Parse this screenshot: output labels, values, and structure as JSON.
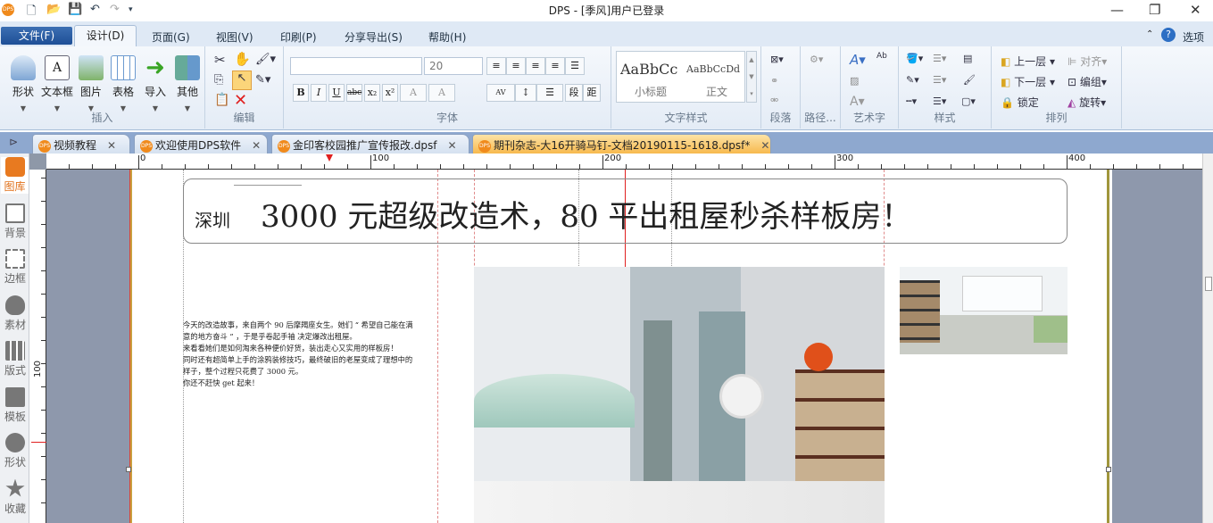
{
  "window": {
    "title": "DPS - [季风]用户已登录",
    "minimize": "—",
    "restore": "❐",
    "close": "✕"
  },
  "quick_access": [
    "new-file",
    "open",
    "save",
    "undo",
    "redo",
    "customize"
  ],
  "menu": {
    "file": "文件(F)",
    "tabs": [
      "设计(D)",
      "页面(G)",
      "视图(V)",
      "印刷(P)",
      "分享导出(S)",
      "帮助(H)"
    ],
    "options": "选项"
  },
  "ribbon": {
    "insert": {
      "label": "插入",
      "items": [
        "形状",
        "文本框",
        "图片",
        "表格",
        "导入",
        "其他"
      ]
    },
    "edit": {
      "label": "编辑"
    },
    "font": {
      "label": "字体",
      "font_name": "",
      "font_size": "20",
      "buttons": [
        "B",
        "I",
        "U",
        "abc",
        "x₂",
        "x²",
        "A",
        "A"
      ],
      "para_buttons": [
        "AV",
        "段",
        "距"
      ]
    },
    "text_style": {
      "label": "文字样式",
      "styles": [
        {
          "sample": "AaBbCc",
          "name": "小标题"
        },
        {
          "sample": "AaBbCcDd",
          "name": "正文"
        }
      ]
    },
    "paragraph": {
      "label": "段落"
    },
    "path": {
      "label": "路径..."
    },
    "art_text": {
      "label": "艺术字"
    },
    "style": {
      "label": "样式"
    },
    "arrange": {
      "label": "排列",
      "items": [
        "上一层",
        "下一层",
        "锁定",
        "对齐",
        "编组",
        "旋转"
      ]
    }
  },
  "doc_tabs": [
    {
      "label": "视频教程",
      "active": false
    },
    {
      "label": "欢迎使用DPS软件",
      "active": false
    },
    {
      "label": "金印客校园推广宣传报改.dpsf",
      "active": false
    },
    {
      "label": "期刊杂志-大16开骑马钉-文档20190115-1618.dpsf*",
      "active": true
    }
  ],
  "sidebar": [
    {
      "label": "图库",
      "icon": "gallery-icon",
      "active": true
    },
    {
      "label": "背景",
      "icon": "background-icon"
    },
    {
      "label": "边框",
      "icon": "border-icon"
    },
    {
      "label": "素材",
      "icon": "material-icon"
    },
    {
      "label": "版式",
      "icon": "layout-icon"
    },
    {
      "label": "模板",
      "icon": "template-icon"
    },
    {
      "label": "形状",
      "icon": "shape-icon"
    },
    {
      "label": "收藏",
      "icon": "favorite-icon"
    }
  ],
  "ruler": {
    "h_labels": [
      "0",
      "100",
      "200",
      "300",
      "400"
    ],
    "v_labels": [
      "100"
    ]
  },
  "document": {
    "city": "深圳",
    "headline": "3000 元超级改造术，80 平出租屋秒杀样板房！",
    "body": [
      "今天的改造故事，来自两个 90 后摩羯座女生。她们 “ 希望自己能在满",
      "意的地方奋斗 ” ，于是乎卷起手袖 决定爆改出租屋。",
      "来看看她们是如何淘来各种便价好货，装出走心又实用的样板房！",
      "同时还有超简单上手的涂鸦装修技巧，最终破旧的老屋变成了理想中的",
      "样子，整个过程只花费了 3000 元。",
      "你还不赶快 get 起来！"
    ]
  },
  "colors": {
    "accent": "#f08a1c",
    "file_button": "#2a5ea6",
    "canvas": "#8e98ac",
    "guide": "#e08a8a"
  }
}
